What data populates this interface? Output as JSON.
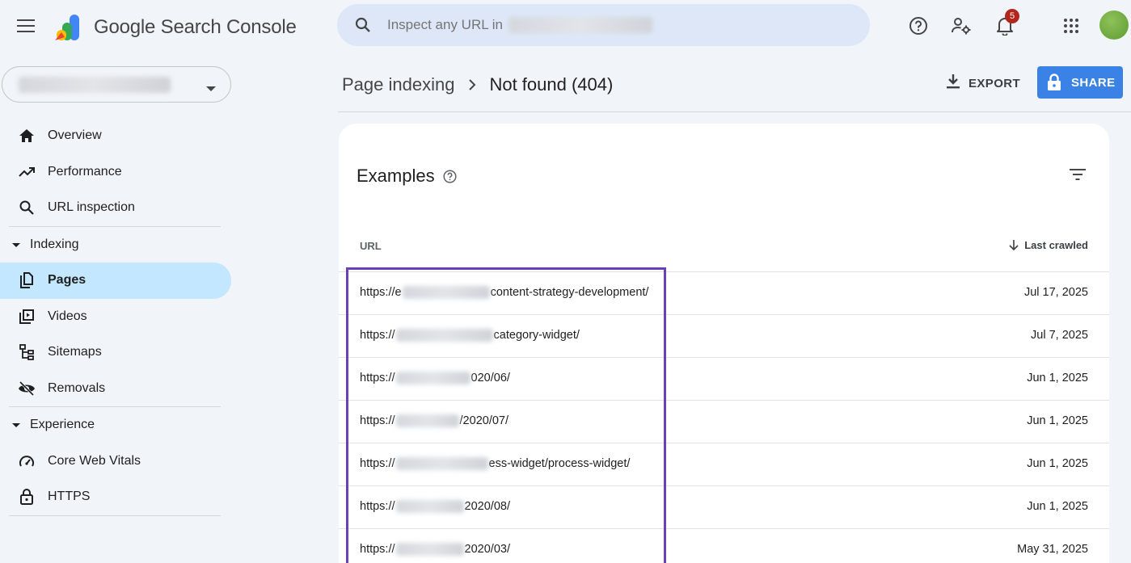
{
  "app": {
    "title": "Google Search Console"
  },
  "search": {
    "placeholder": "Inspect any URL in"
  },
  "notifications": {
    "count": "5"
  },
  "icons": {
    "menu": "hamburger-menu-icon",
    "search": "search-icon",
    "help": "help-circle-icon",
    "account_settings": "manage-accounts-icon",
    "notifications": "bell-icon",
    "apps": "apps-grid-icon"
  },
  "sidebar": {
    "items": [
      {
        "label": "Overview",
        "icon": "home-icon"
      },
      {
        "label": "Performance",
        "icon": "trending-up-icon"
      },
      {
        "label": "URL inspection",
        "icon": "search-icon"
      }
    ],
    "indexing": {
      "label": "Indexing",
      "items": [
        {
          "label": "Pages",
          "icon": "pages-icon",
          "active": true
        },
        {
          "label": "Videos",
          "icon": "video-library-icon"
        },
        {
          "label": "Sitemaps",
          "icon": "sitemap-icon"
        },
        {
          "label": "Removals",
          "icon": "visibility-off-icon"
        }
      ]
    },
    "experience": {
      "label": "Experience",
      "items": [
        {
          "label": "Core Web Vitals",
          "icon": "speed-gauge-icon"
        },
        {
          "label": "HTTPS",
          "icon": "lock-icon"
        }
      ]
    }
  },
  "breadcrumb": {
    "parent": "Page indexing",
    "current": "Not found (404)"
  },
  "actions": {
    "export": "EXPORT",
    "share": "SHARE"
  },
  "colors": {
    "accent": "#3b82e6",
    "active_nav": "#c2e7ff",
    "highlight_border": "#6c3fb8",
    "badge": "#b3261e"
  },
  "examples": {
    "title": "Examples",
    "columns": {
      "url": "URL",
      "last_crawled": "Last crawled"
    },
    "rows": [
      {
        "url_prefix": "https://e",
        "url_suffix": "content-strategy-development/",
        "date": "Jul 17, 2025"
      },
      {
        "url_prefix": "https://",
        "url_suffix": "category-widget/",
        "date": "Jul 7, 2025"
      },
      {
        "url_prefix": "https://",
        "url_suffix": "020/06/",
        "date": "Jun 1, 2025"
      },
      {
        "url_prefix": "https://",
        "url_suffix": "/2020/07/",
        "date": "Jun 1, 2025"
      },
      {
        "url_prefix": "https://",
        "url_suffix": "ess-widget/process-widget/",
        "date": "Jun 1, 2025"
      },
      {
        "url_prefix": "https://",
        "url_suffix": "2020/08/",
        "date": "Jun 1, 2025"
      },
      {
        "url_prefix": "https://",
        "url_suffix": "2020/03/",
        "date": "May 31, 2025"
      }
    ]
  }
}
